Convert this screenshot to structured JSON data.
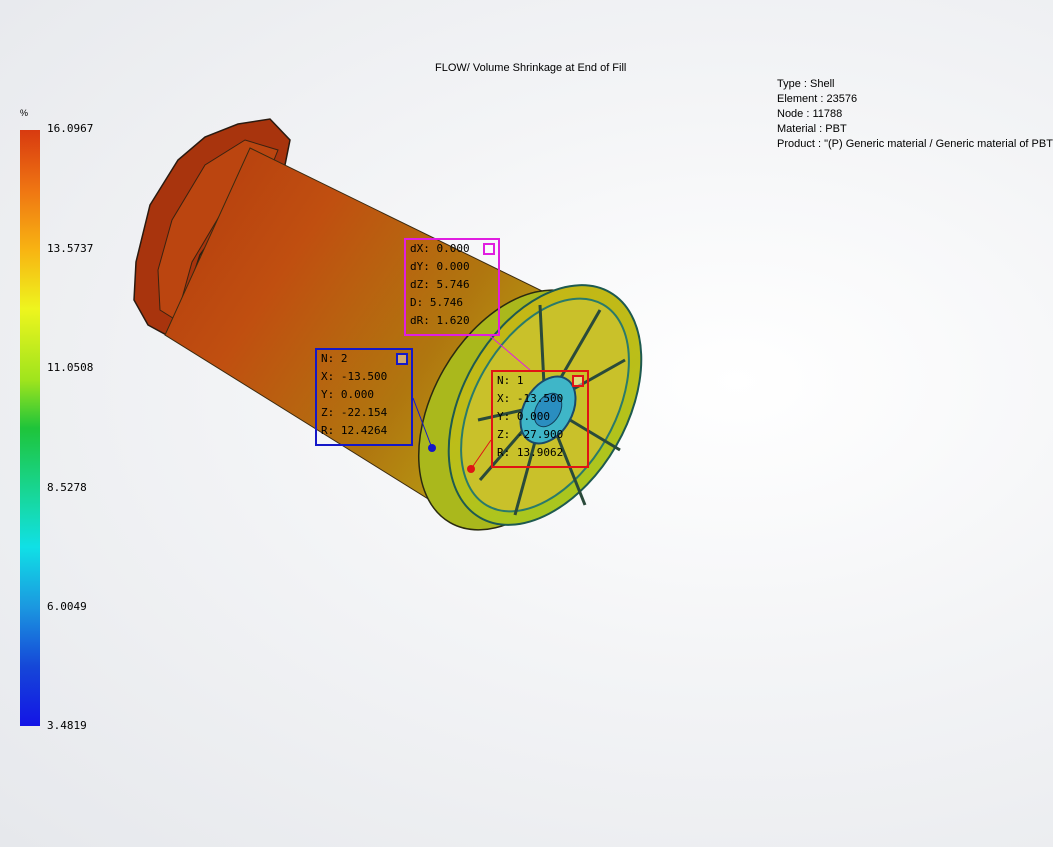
{
  "title": "FLOW/ Volume Shrinkage at End of Fill",
  "info": {
    "type": "Type : Shell",
    "element": "Element : 23576",
    "node": "Node : 11788",
    "material": "Material : PBT",
    "product": "Product :   \"(P)  Generic material / Generic material of PBT"
  },
  "legend": {
    "unit": "%",
    "ticks": [
      "16.0967",
      "13.5737",
      "11.0508",
      "8.5278",
      "6.0049",
      "3.4819"
    ]
  },
  "probes": {
    "delta": {
      "lines": [
        "dX: 0.000",
        "dY: 0.000",
        "dZ: 5.746",
        "D: 5.746",
        "dR: 1.620"
      ],
      "color": "#e01ee0"
    },
    "node2": {
      "lines": [
        "N: 2",
        "X: -13.500",
        "Y: 0.000",
        "Z: -22.154",
        "R: 12.4264"
      ],
      "color": "#1418c8"
    },
    "node1": {
      "lines": [
        "N: 1",
        "X: -13.500",
        "Y: 0.000",
        "Z: -27.900",
        "R: 13.9062"
      ],
      "color": "#e01414"
    }
  },
  "colors": {
    "max": "#d83a10",
    "mid": "#1ec43a",
    "min": "#1414e6"
  }
}
